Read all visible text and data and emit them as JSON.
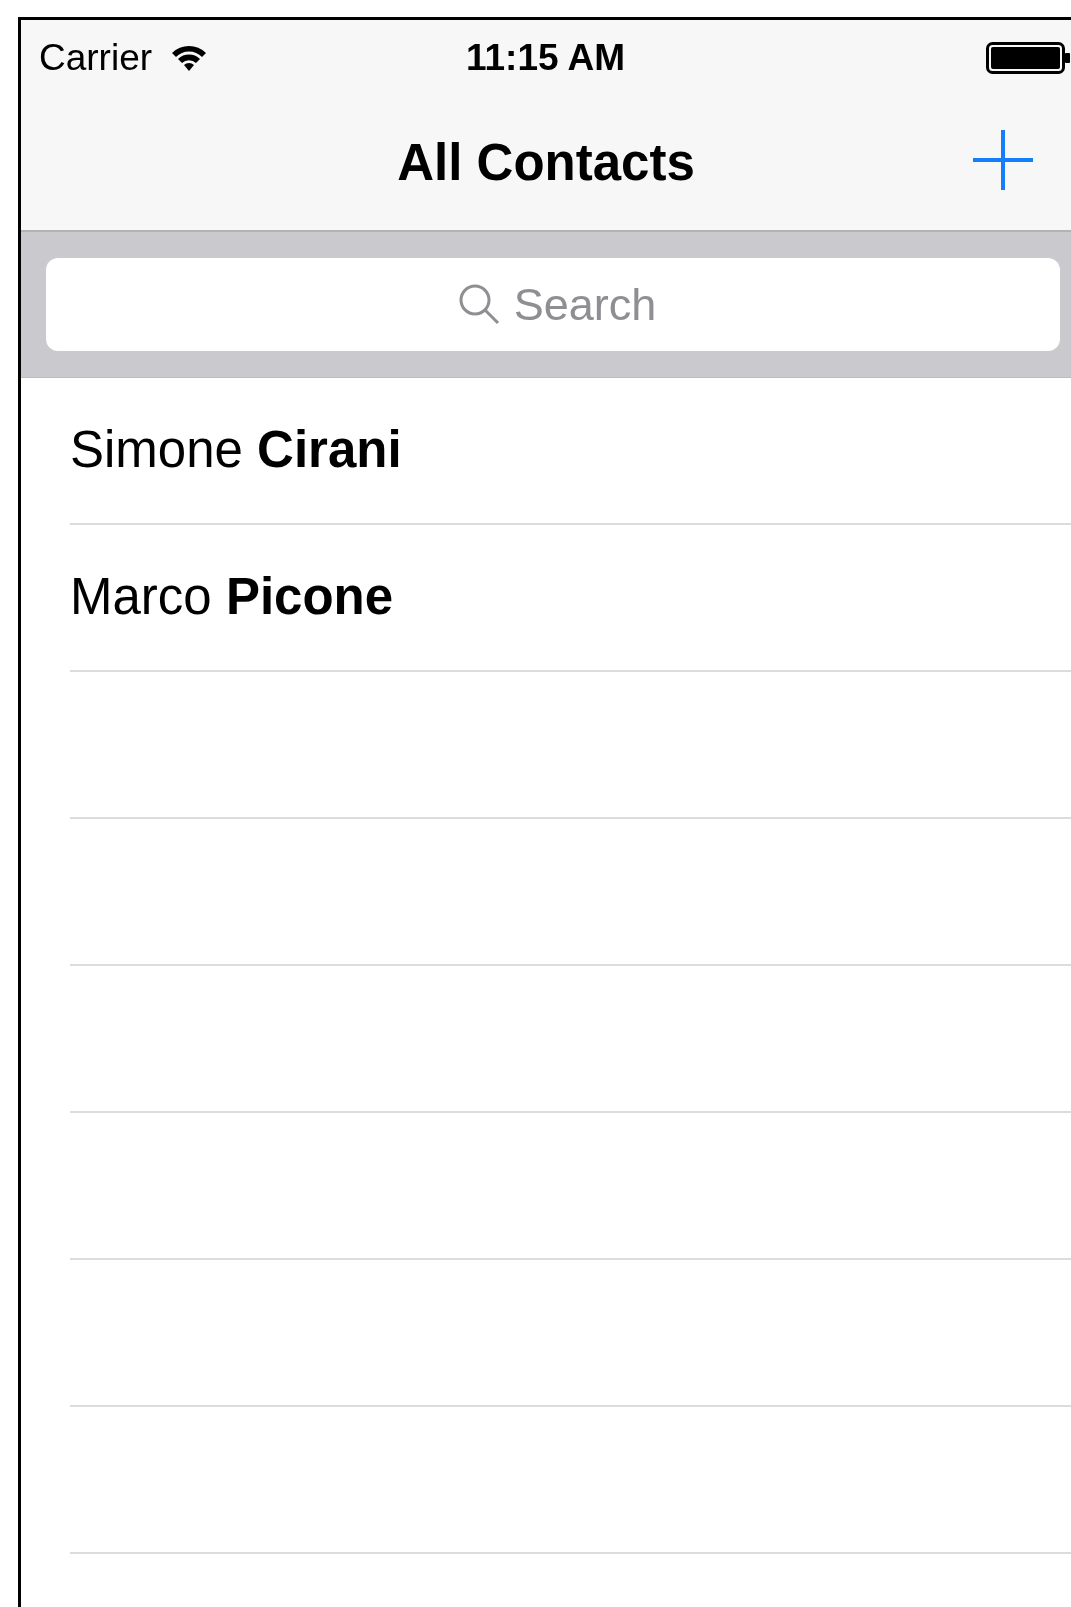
{
  "status_bar": {
    "carrier": "Carrier",
    "time": "11:15 AM"
  },
  "nav_bar": {
    "title": "All Contacts"
  },
  "search": {
    "placeholder": "Search"
  },
  "contacts": [
    {
      "name": "Simone **Cirani**"
    },
    {
      "name": "Marco **Picone**"
    }
  ]
}
